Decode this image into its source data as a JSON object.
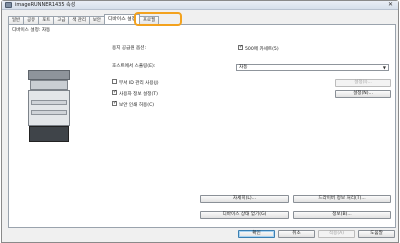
{
  "window": {
    "title": "imageRUNNER1435 속성"
  },
  "tabs": [
    {
      "label": "일반",
      "active": false
    },
    {
      "label": "공유",
      "active": false
    },
    {
      "label": "포트",
      "active": false
    },
    {
      "label": "고급",
      "active": false
    },
    {
      "label": "색 관리",
      "active": false
    },
    {
      "label": "보안",
      "active": false
    },
    {
      "label": "디바이스 설정",
      "active": true
    },
    {
      "label": "프로필",
      "active": false
    }
  ],
  "panel": {
    "settings_label": "디바이스 설정: 자동",
    "paper_source_label": "용지 공급원 옵션:",
    "cassette_option": "500매 카세트(5)",
    "spooling_label": "호스트에서 스풀링(E):",
    "spooling_value": "자동",
    "dept_id_label": "부서 ID 관리 사용(J)",
    "user_info_label": "사용자 정보 설정(T)",
    "secure_print_label": "보안 인쇄 허용(C)",
    "settings_button": "설정(I)...",
    "settings2_button": "설정(N)...",
    "details_button": "자세히(L)...",
    "driver_info_button": "드라이버 정보 처리(T)...",
    "get_device_status_button": "디바이스 상태 얻기(G)",
    "about_button": "정보(B)..."
  },
  "footer": {
    "ok": "확인",
    "cancel": "취소",
    "apply": "적용(A)",
    "help": "도움말"
  },
  "checkboxes": {
    "cassette": true,
    "dept_id": false,
    "user_info": true,
    "secure_print": true
  }
}
